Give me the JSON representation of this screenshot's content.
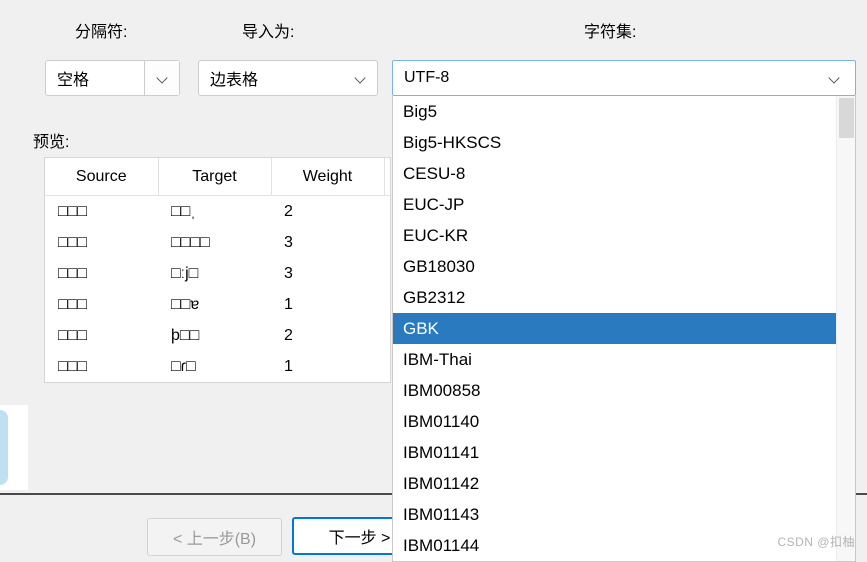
{
  "labels": {
    "delimiter": "分隔符:",
    "import_as": "导入为:",
    "charset": "字符集:",
    "preview": "预览:"
  },
  "combos": {
    "delimiter": {
      "value": "空格",
      "arrow_icon": "chevron-down-icon"
    },
    "import_as": {
      "value": "边表格",
      "arrow_icon": "chevron-down-icon"
    },
    "charset": {
      "value": "UTF-8",
      "arrow_icon": "chevron-down-icon"
    }
  },
  "preview_table": {
    "columns": [
      "Source",
      "Target",
      "Weight",
      ""
    ],
    "rows": [
      {
        "source": "□□□",
        "target": "□□ˌ",
        "weight": "2"
      },
      {
        "source": "□□□",
        "target": "□□□□",
        "weight": "3"
      },
      {
        "source": "□□□",
        "target": "□ːj□",
        "weight": "3"
      },
      {
        "source": "□□□",
        "target": "□□ɐ",
        "weight": "1"
      },
      {
        "source": "□□□",
        "target": "þ□□",
        "weight": "2"
      },
      {
        "source": "□□□",
        "target": "□ɾ□",
        "weight": "1"
      }
    ]
  },
  "charset_dropdown": {
    "selected": "GBK",
    "options": [
      "Big5",
      "Big5-HKSCS",
      "CESU-8",
      "EUC-JP",
      "EUC-KR",
      "GB18030",
      "GB2312",
      "GBK",
      "IBM-Thai",
      "IBM00858",
      "IBM01140",
      "IBM01141",
      "IBM01142",
      "IBM01143",
      "IBM01144"
    ]
  },
  "buttons": {
    "back": "< 上一步(B)",
    "next": "下一步 >"
  },
  "watermark": "CSDN @扣柚",
  "colors": {
    "accent": "#0078d7",
    "selection": "#2a7ac0",
    "focus_border": "#7eb4e2",
    "window_bg": "#f0f0f0",
    "disabled_text": "#9a9a9a"
  }
}
